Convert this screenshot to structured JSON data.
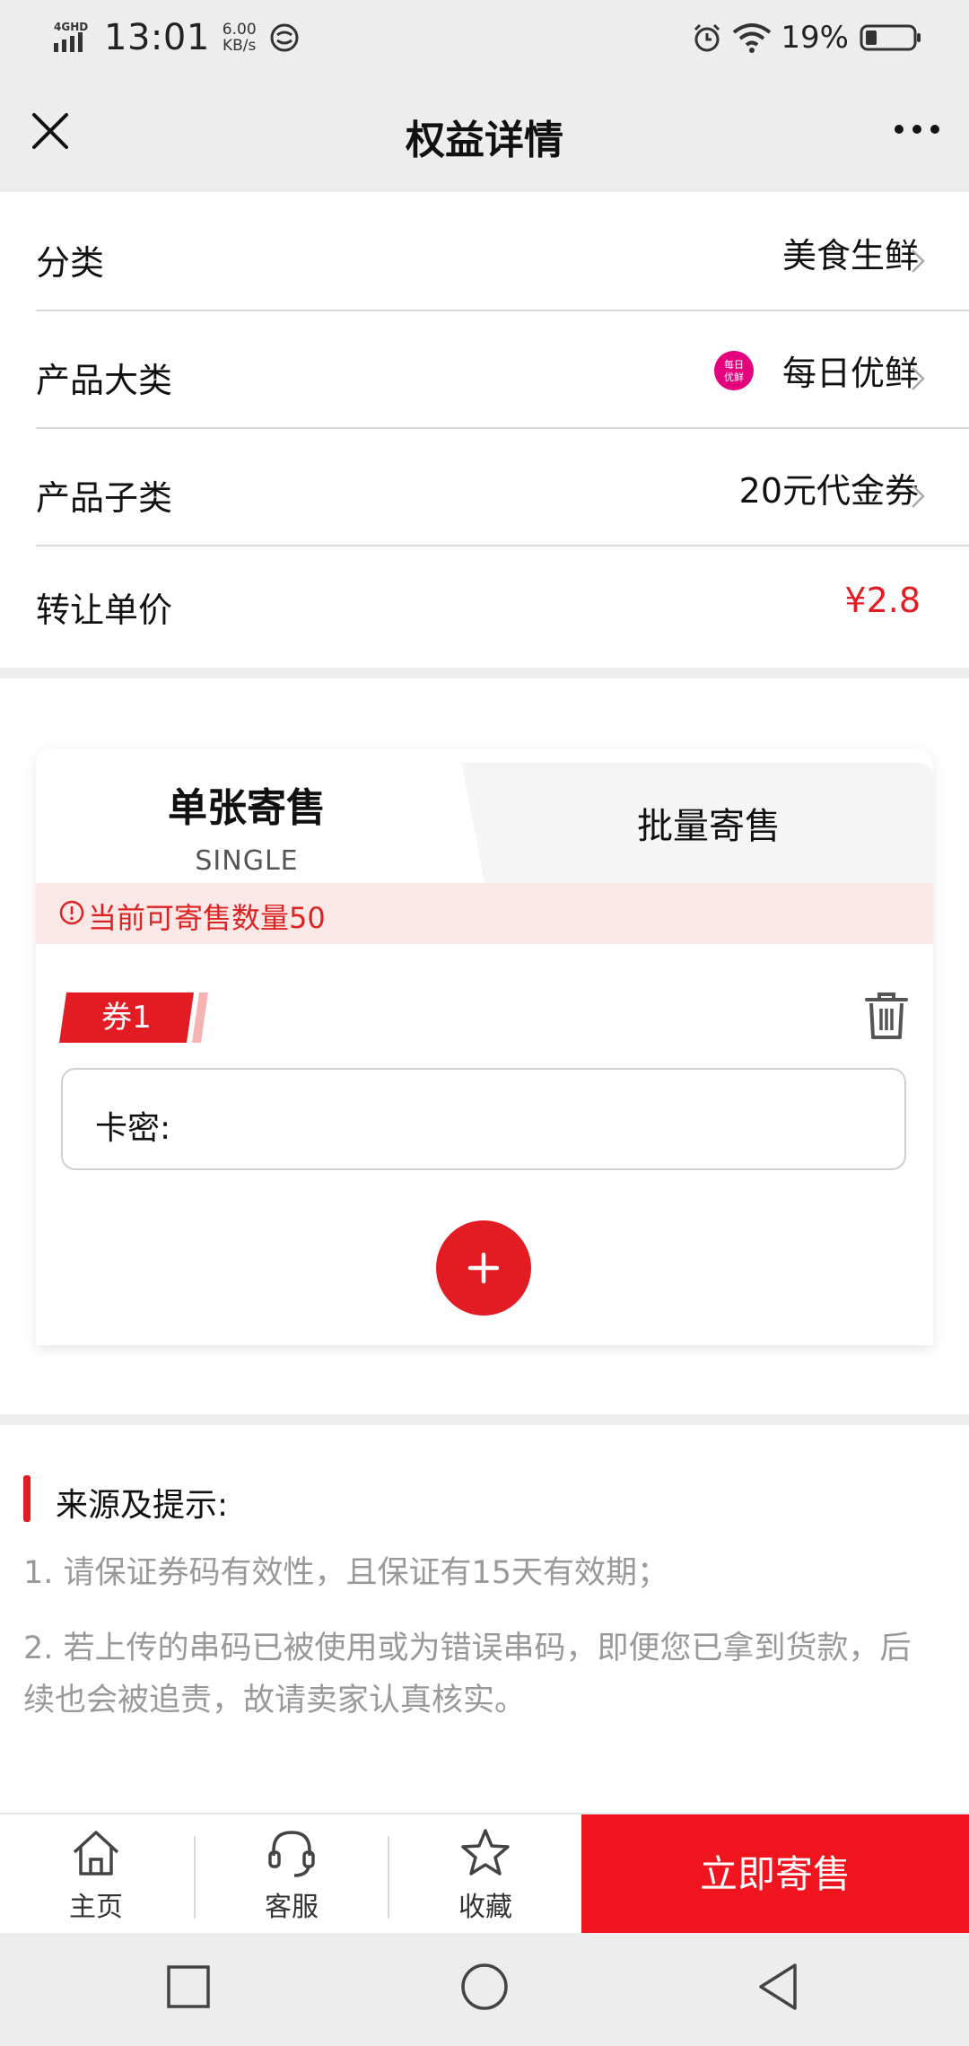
{
  "status_bar": {
    "network": "4GHD",
    "time": "13:01",
    "speed_value": "6.00",
    "speed_unit": "KB/s",
    "battery_percent": "19%"
  },
  "nav": {
    "title": "权益详情"
  },
  "info_rows": [
    {
      "label": "分类",
      "value": "美食生鲜"
    },
    {
      "label": "产品大类",
      "value": "每日优鲜",
      "logo_text_1": "每日",
      "logo_text_2": "优鲜"
    },
    {
      "label": "产品子类",
      "value": "20元代金券"
    },
    {
      "label": "转让单价",
      "value": "¥2.8"
    }
  ],
  "card": {
    "tab_single_title": "单张寄售",
    "tab_single_sub": "SINGLE",
    "tab_batch": "批量寄售",
    "notice": "当前可寄售数量50",
    "coupon_label": "券1",
    "input_label": "卡密:"
  },
  "tips": {
    "title": "来源及提示:",
    "items": [
      "1. 请保证券码有效性，且保证有15天有效期；",
      "2. 若上传的串码已被使用或为错误串码，即便您已拿到货款，后续也会被追责，故请卖家认真核实。"
    ]
  },
  "bottom_bar": {
    "home": "主页",
    "service": "客服",
    "favorite": "收藏",
    "sell_now": "立即寄售"
  },
  "colors": {
    "accent": "#e31c24",
    "sell_button": "#ef141e",
    "brand_logo": "#e5007e"
  }
}
